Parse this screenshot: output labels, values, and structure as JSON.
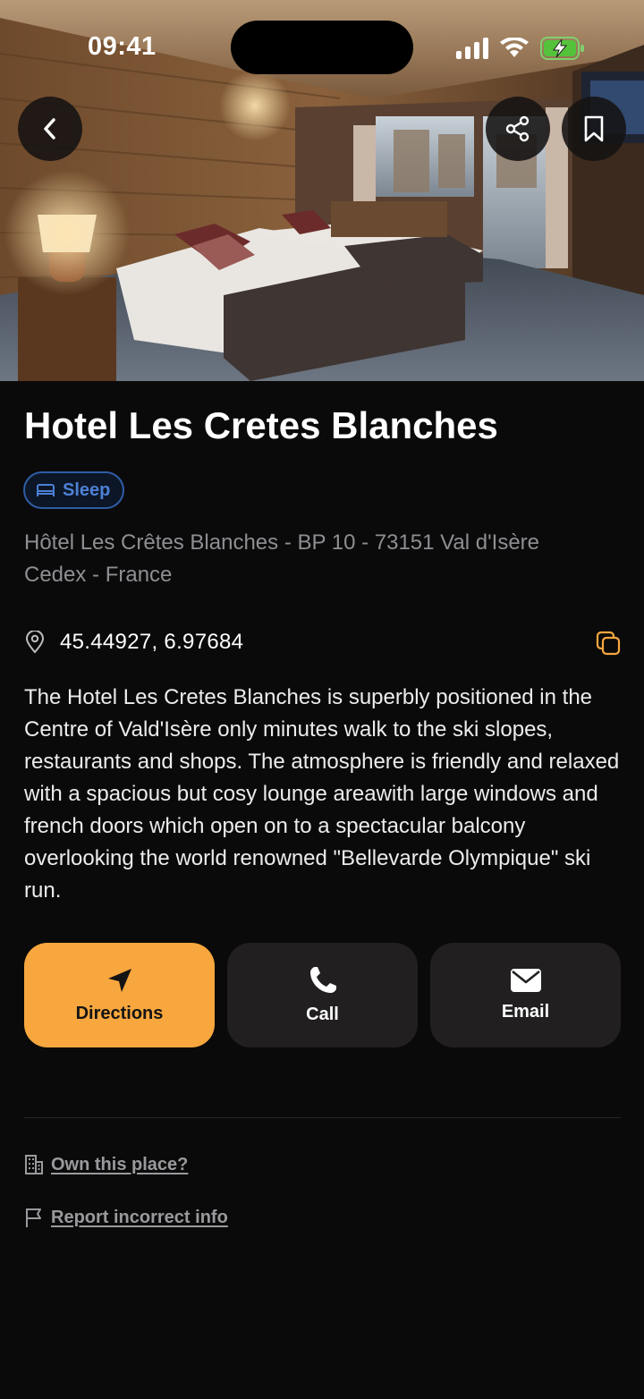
{
  "status_bar": {
    "time": "09:41"
  },
  "header": {
    "back_icon": "chevron-left-icon",
    "share_icon": "share-icon",
    "bookmark_icon": "bookmark-icon"
  },
  "place": {
    "title": "Hotel Les Cretes Blanches",
    "category": {
      "label": "Sleep",
      "icon": "bed-icon",
      "color": "#4d80d6"
    },
    "address": "Hôtel Les Crêtes Blanches - BP 10 - 73151 Val d'Isère Cedex - France",
    "coordinates": "45.44927, 6.97684",
    "description": "The Hotel Les Cretes Blanches is superbly positioned in the Centre of Vald'Isère only minutes walk to the ski slopes, restaurants and shops. The atmosphere is friendly and relaxed with a spacious but cosy lounge areawith large windows and french doors which open on to a spectacular balcony overlooking the world renowned \"Bellevarde Olympique\" ski run."
  },
  "actions": {
    "directions": {
      "label": "Directions",
      "icon": "navigation-arrow-icon",
      "color": "#f8a73e"
    },
    "call": {
      "label": "Call",
      "icon": "phone-icon"
    },
    "email": {
      "label": "Email",
      "icon": "envelope-icon"
    }
  },
  "links": {
    "own": {
      "label": "Own this place?",
      "icon": "building-icon"
    },
    "report": {
      "label": "Report incorrect info",
      "icon": "flag-icon"
    }
  },
  "colors": {
    "background": "#0b0a0a",
    "accent": "#f8a73e",
    "card": "#211f1f",
    "muted_text": "#8e8e93"
  }
}
